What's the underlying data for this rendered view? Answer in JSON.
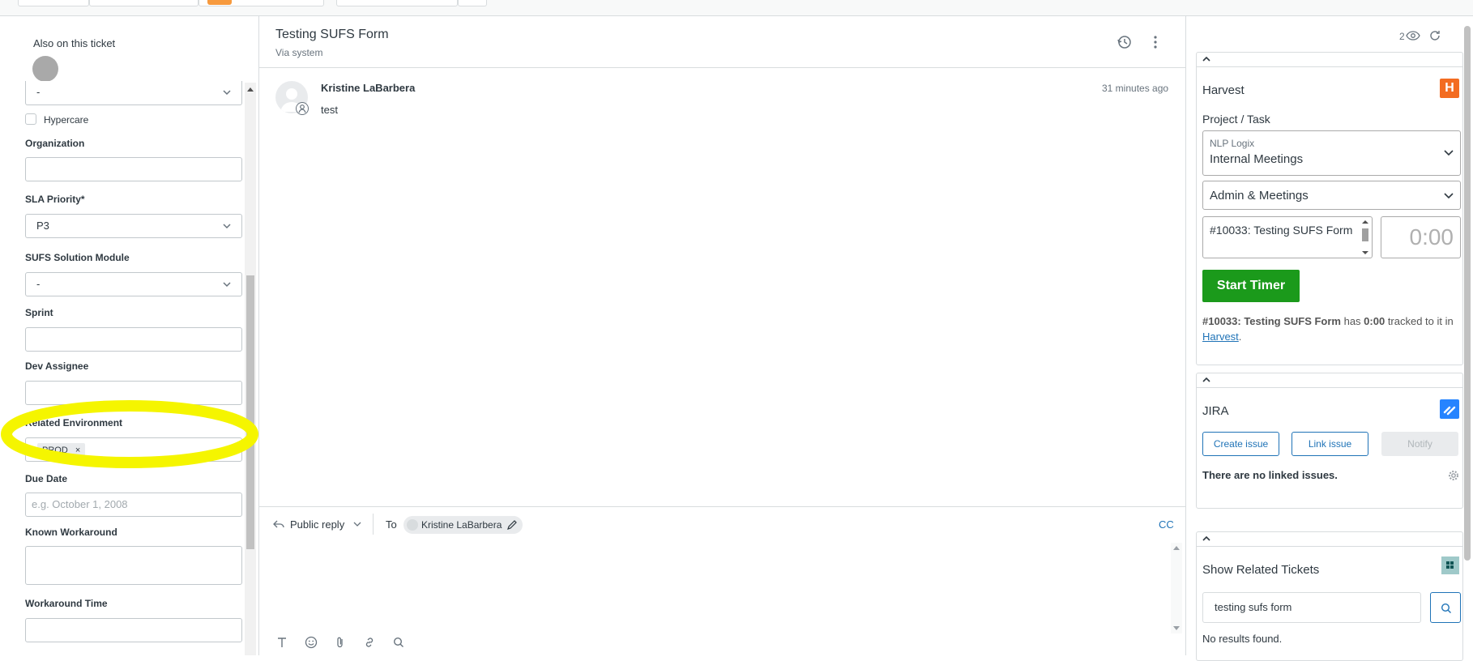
{
  "left": {
    "also_on_ticket": "Also on this ticket",
    "first_select_value": "-",
    "hypercare_label": "Hypercare",
    "organization_label": "Organization",
    "sla_priority_label": "SLA Priority*",
    "sla_priority_value": "P3",
    "sufs_module_label": "SUFS Solution Module",
    "sufs_module_value": "-",
    "sprint_label": "Sprint",
    "dev_assignee_label": "Dev Assignee",
    "related_env_label": "Related Environment",
    "related_env_tag": "PROD",
    "tag_remove": "×",
    "due_date_label": "Due Date",
    "due_date_placeholder": "e.g. October 1, 2008",
    "known_workaround_label": "Known Workaround",
    "workaround_time_label": "Workaround Time"
  },
  "center": {
    "title": "Testing SUFS Form",
    "subtitle": "Via system",
    "message": {
      "author": "Kristine LaBarbera",
      "time": "31 minutes ago",
      "body": "test"
    },
    "reply": {
      "mode": "Public reply",
      "to_label": "To",
      "recipient": "Kristine LaBarbera",
      "cc": "CC"
    }
  },
  "right": {
    "viewer_count": "2",
    "harvest": {
      "title": "Harvest",
      "logo_letter": "H",
      "project_task_label": "Project / Task",
      "client": "NLP Logix",
      "project": "Internal Meetings",
      "task": "Admin & Meetings",
      "notes": "#10033: Testing SUFS Form",
      "time_placeholder": "0:00",
      "start_timer": "Start Timer",
      "summary_ticket": "#10033: Testing SUFS Form",
      "summary_has": " has ",
      "summary_time": "0:00",
      "summary_tracked": " tracked to it in ",
      "summary_link": "Harvest",
      "summary_end": "."
    },
    "jira": {
      "title": "JIRA",
      "create": "Create issue",
      "link": "Link issue",
      "notify": "Notify",
      "no_linked": "There are no linked issues."
    },
    "related": {
      "title": "Show Related Tickets",
      "search_value": "testing sufs form",
      "no_results": "No results found."
    }
  },
  "colors": {
    "highlight": "#f5f500",
    "start_timer": "#1b9a1b",
    "harvest_logo": "#f36c21",
    "jira_logo": "#2684ff",
    "link_blue": "#1f73b7"
  }
}
